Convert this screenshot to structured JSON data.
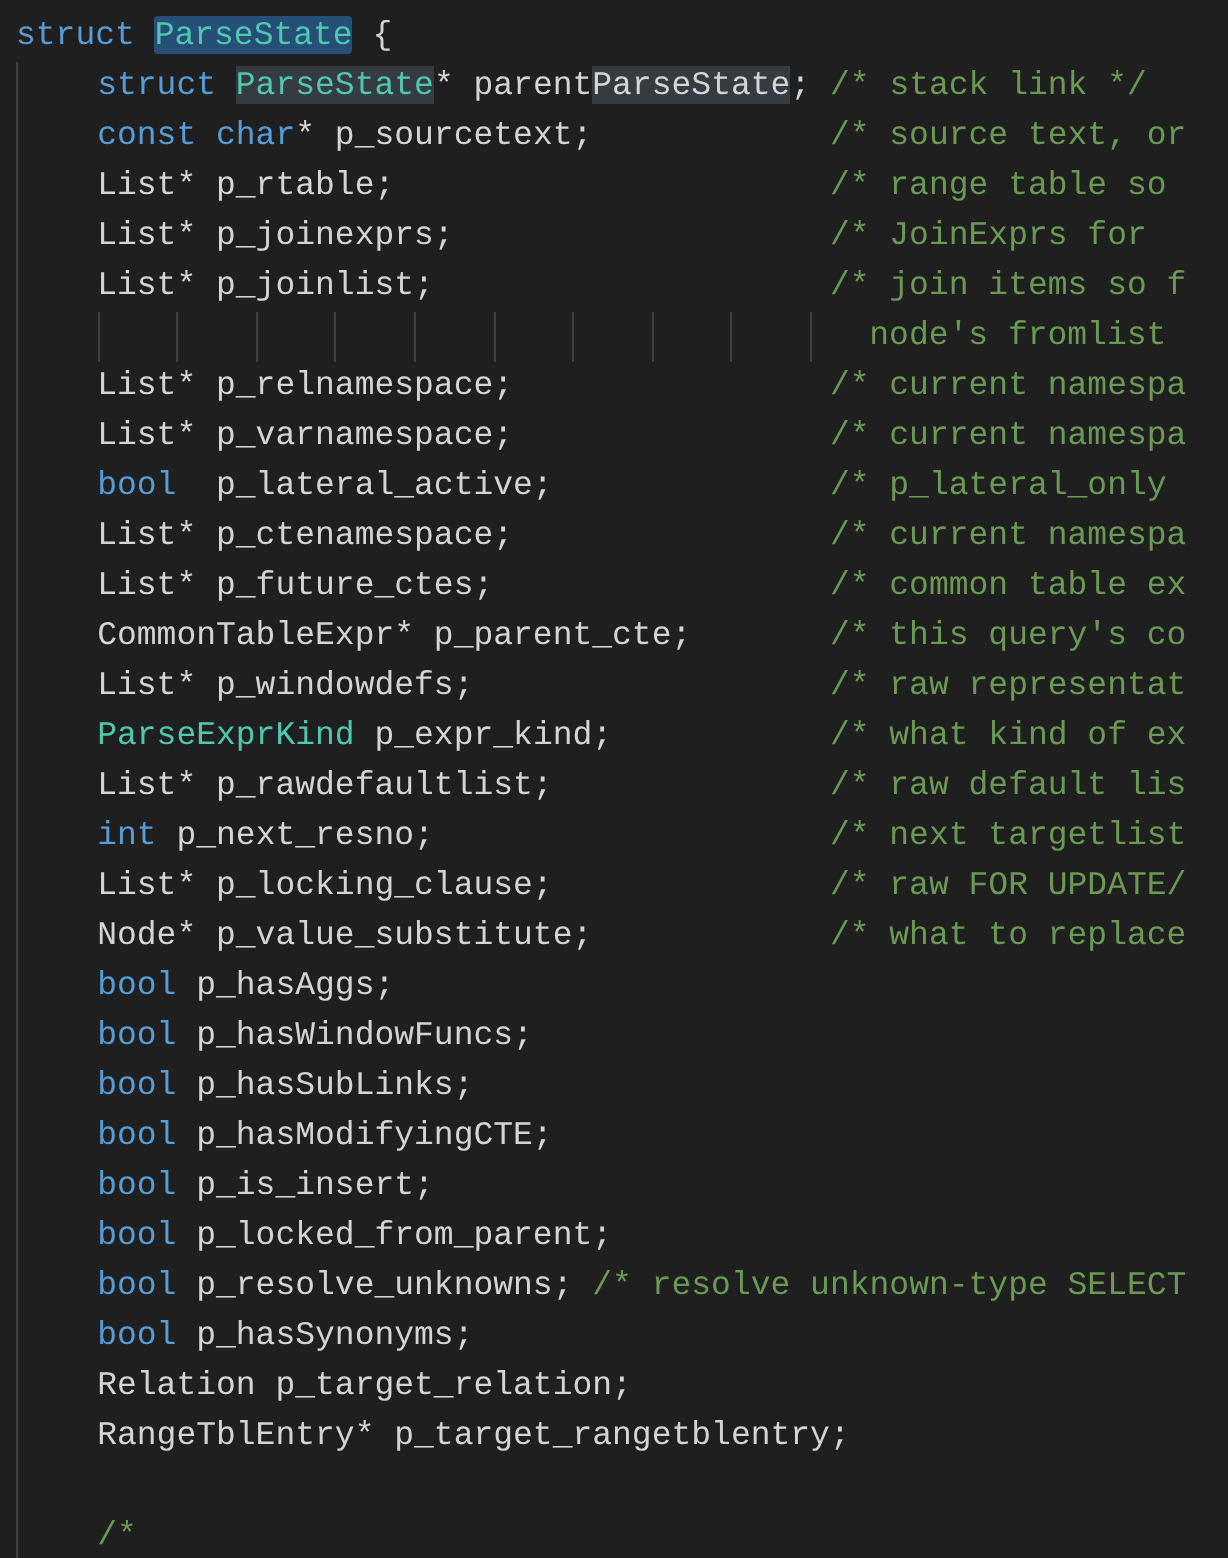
{
  "header": [
    {
      "kind": "keyword",
      "text": "struct "
    },
    {
      "kind": "type",
      "text": "ParseState",
      "selected": true
    },
    {
      "kind": "plain",
      "text": " {"
    }
  ],
  "members": [
    {
      "kind": "field",
      "tokens": [
        {
          "kind": "keyword",
          "text": "struct "
        },
        {
          "kind": "type",
          "text": "ParseState",
          "match": true
        },
        {
          "kind": "plain",
          "text": "* parent"
        },
        {
          "kind": "plain",
          "text": "ParseState",
          "match": true
        },
        {
          "kind": "plain",
          "text": ";"
        }
      ],
      "comment": "/* stack link */",
      "aligned": false
    },
    {
      "kind": "field",
      "tokens": [
        {
          "kind": "keyword",
          "text": "const char"
        },
        {
          "kind": "plain",
          "text": "* p_sourcetext;"
        }
      ],
      "comment": "/* source text, or",
      "aligned": true
    },
    {
      "kind": "field",
      "tokens": [
        {
          "kind": "plain",
          "text": "List* p_rtable;"
        }
      ],
      "comment": "/* range table so",
      "aligned": true
    },
    {
      "kind": "field",
      "tokens": [
        {
          "kind": "plain",
          "text": "List* p_joinexprs;"
        }
      ],
      "comment": "/* JoinExprs for",
      "aligned": true
    },
    {
      "kind": "field",
      "tokens": [
        {
          "kind": "plain",
          "text": "List* p_joinlist;"
        }
      ],
      "comment": "/* join items so f",
      "aligned": true
    },
    {
      "kind": "continuation",
      "comment": "node's fromlist"
    },
    {
      "kind": "field",
      "tokens": [
        {
          "kind": "plain",
          "text": "List* p_relnamespace;"
        }
      ],
      "comment": "/* current namespa",
      "aligned": true
    },
    {
      "kind": "field",
      "tokens": [
        {
          "kind": "plain",
          "text": "List* p_varnamespace;"
        }
      ],
      "comment": "/* current namespa",
      "aligned": true
    },
    {
      "kind": "field",
      "tokens": [
        {
          "kind": "keyword",
          "text": "bool"
        },
        {
          "kind": "plain",
          "text": "  p_lateral_active;"
        }
      ],
      "comment": "/* p_lateral_only",
      "aligned": true
    },
    {
      "kind": "field",
      "tokens": [
        {
          "kind": "plain",
          "text": "List* p_ctenamespace;"
        }
      ],
      "comment": "/* current namespa",
      "aligned": true
    },
    {
      "kind": "field",
      "tokens": [
        {
          "kind": "plain",
          "text": "List* p_future_ctes;"
        }
      ],
      "comment": "/* common table ex",
      "aligned": true
    },
    {
      "kind": "field",
      "tokens": [
        {
          "kind": "plain",
          "text": "CommonTableExpr* p_parent_cte;"
        }
      ],
      "comment": "/* this query's co",
      "aligned": true
    },
    {
      "kind": "field",
      "tokens": [
        {
          "kind": "plain",
          "text": "List* p_windowdefs;"
        }
      ],
      "comment": "/* raw representat",
      "aligned": true
    },
    {
      "kind": "field",
      "tokens": [
        {
          "kind": "type",
          "text": "ParseExprKind"
        },
        {
          "kind": "plain",
          "text": " p_expr_kind;"
        }
      ],
      "comment": "/* what kind of ex",
      "aligned": true
    },
    {
      "kind": "field",
      "tokens": [
        {
          "kind": "plain",
          "text": "List* p_rawdefaultlist;"
        }
      ],
      "comment": "/* raw default lis",
      "aligned": true
    },
    {
      "kind": "field",
      "tokens": [
        {
          "kind": "keyword",
          "text": "int"
        },
        {
          "kind": "plain",
          "text": " p_next_resno;"
        }
      ],
      "comment": "/* next targetlist",
      "aligned": true
    },
    {
      "kind": "field",
      "tokens": [
        {
          "kind": "plain",
          "text": "List* p_locking_clause;"
        }
      ],
      "comment": "/* raw FOR UPDATE/",
      "aligned": true
    },
    {
      "kind": "field",
      "tokens": [
        {
          "kind": "plain",
          "text": "Node* p_value_substitute;"
        }
      ],
      "comment": "/* what to replace",
      "aligned": true
    },
    {
      "kind": "field",
      "tokens": [
        {
          "kind": "keyword",
          "text": "bool"
        },
        {
          "kind": "plain",
          "text": " p_hasAggs;"
        }
      ]
    },
    {
      "kind": "field",
      "tokens": [
        {
          "kind": "keyword",
          "text": "bool"
        },
        {
          "kind": "plain",
          "text": " p_hasWindowFuncs;"
        }
      ]
    },
    {
      "kind": "field",
      "tokens": [
        {
          "kind": "keyword",
          "text": "bool"
        },
        {
          "kind": "plain",
          "text": " p_hasSubLinks;"
        }
      ]
    },
    {
      "kind": "field",
      "tokens": [
        {
          "kind": "keyword",
          "text": "bool"
        },
        {
          "kind": "plain",
          "text": " p_hasModifyingCTE;"
        }
      ]
    },
    {
      "kind": "field",
      "tokens": [
        {
          "kind": "keyword",
          "text": "bool"
        },
        {
          "kind": "plain",
          "text": " p_is_insert;"
        }
      ]
    },
    {
      "kind": "field",
      "tokens": [
        {
          "kind": "keyword",
          "text": "bool"
        },
        {
          "kind": "plain",
          "text": " p_locked_from_parent;"
        }
      ]
    },
    {
      "kind": "field",
      "tokens": [
        {
          "kind": "keyword",
          "text": "bool"
        },
        {
          "kind": "plain",
          "text": " p_resolve_unknowns;"
        }
      ],
      "comment": "/* resolve unknown-type SELECT",
      "aligned": false
    },
    {
      "kind": "field",
      "tokens": [
        {
          "kind": "keyword",
          "text": "bool"
        },
        {
          "kind": "plain",
          "text": " p_hasSynonyms;"
        }
      ]
    },
    {
      "kind": "field",
      "tokens": [
        {
          "kind": "plain",
          "text": "Relation p_target_relation;"
        }
      ]
    },
    {
      "kind": "field",
      "tokens": [
        {
          "kind": "plain",
          "text": "RangeTblEntry* p_target_rangetblentry;"
        }
      ]
    },
    {
      "kind": "blank"
    },
    {
      "kind": "comment_start",
      "comment": "/*"
    }
  ]
}
